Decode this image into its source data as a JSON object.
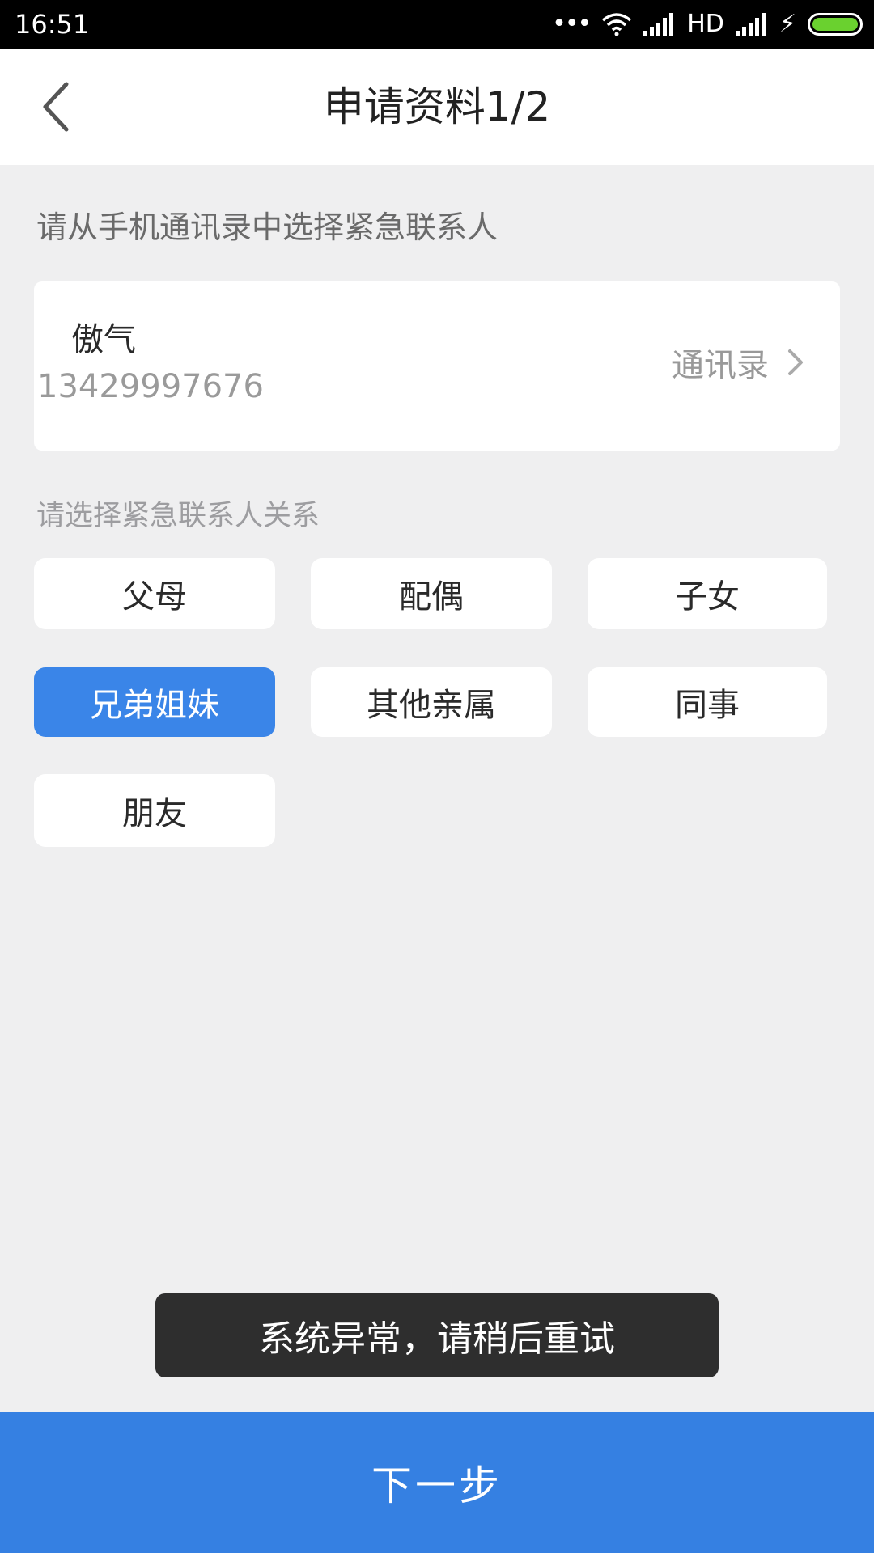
{
  "status_bar": {
    "time": "16:51",
    "network_label": "HD",
    "icons": [
      "more-dots-icon",
      "wifi-icon",
      "signal-icon",
      "signal-icon",
      "charging-icon",
      "battery-icon"
    ],
    "battery_color": "#6ad12f"
  },
  "header": {
    "title": "申请资料1/2",
    "back_icon": "chevron-left-icon"
  },
  "contact_section": {
    "label": "请从手机通讯录中选择紧急联系人",
    "name": "傲气",
    "phone": "13429997676",
    "contacts_link_label": "通讯录",
    "contacts_link_icon": "chevron-right-icon"
  },
  "relation_section": {
    "label": "请选择紧急联系人关系",
    "options": [
      {
        "label": "父母",
        "selected": false
      },
      {
        "label": "配偶",
        "selected": false
      },
      {
        "label": "子女",
        "selected": false
      },
      {
        "label": "兄弟姐妹",
        "selected": true
      },
      {
        "label": "其他亲属",
        "selected": false
      },
      {
        "label": "同事",
        "selected": false
      },
      {
        "label": "朋友",
        "selected": false
      }
    ],
    "selected_color": "#3a85e8"
  },
  "toast": {
    "message": "系统异常，请稍后重试"
  },
  "footer": {
    "next_label": "下一步",
    "button_color": "#3580e2"
  }
}
